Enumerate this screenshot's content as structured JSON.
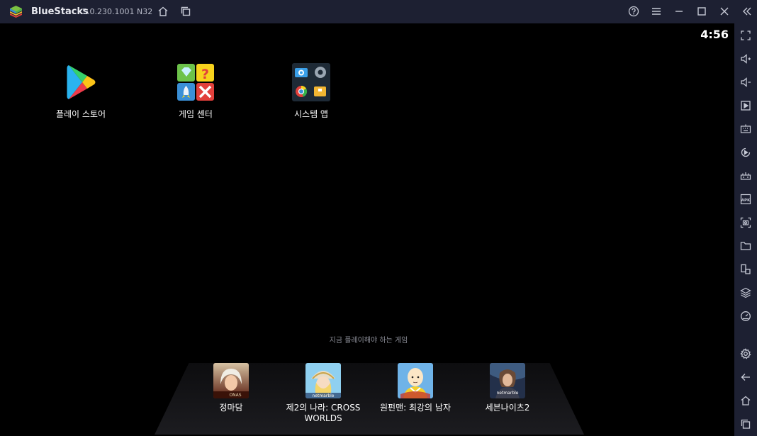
{
  "window": {
    "app_name": "BlueStacks",
    "version": "5.0.230.1001 N32"
  },
  "status": {
    "time": "4:56"
  },
  "home_apps": [
    {
      "label": "플레이 스토어",
      "icon": "play-store-icon"
    },
    {
      "label": "게임 센터",
      "icon": "game-center-icon"
    },
    {
      "label": "시스템 앱",
      "icon": "system-apps-icon"
    }
  ],
  "recommendations": {
    "title": "지금 플레이해야 하는 게임",
    "games": [
      {
        "label": "정마담",
        "thumb_text": "ONAS"
      },
      {
        "label": "제2의 나라: CROSS WORLDS",
        "thumb_text": "netmarble"
      },
      {
        "label": "원펀맨: 최강의 남자",
        "thumb_text": ""
      },
      {
        "label": "세븐나이츠2",
        "thumb_text": "netmarble"
      }
    ]
  },
  "titlebar_controls": [
    "home-icon",
    "multi-instance-icon",
    "help-icon",
    "menu-icon",
    "minimize-icon",
    "maximize-icon",
    "close-icon",
    "collapse-sidebar-icon"
  ],
  "sidebar_tools": [
    "fullscreen-icon",
    "volume-up-icon",
    "volume-down-icon",
    "media-icon",
    "keyboard-icon",
    "macro-icon",
    "game-controls-icon",
    "install-apk-icon",
    "screenshot-icon",
    "folder-icon",
    "multi-instance-icon",
    "layers-icon",
    "eco-mode-icon",
    "settings-icon",
    "back-icon",
    "home-icon",
    "recent-apps-icon"
  ],
  "colors": {
    "titlebar_bg": "#1d2032",
    "screen_bg": "#000000",
    "sidebar_bg": "#1d2032",
    "icon_color": "#c7cad6"
  }
}
